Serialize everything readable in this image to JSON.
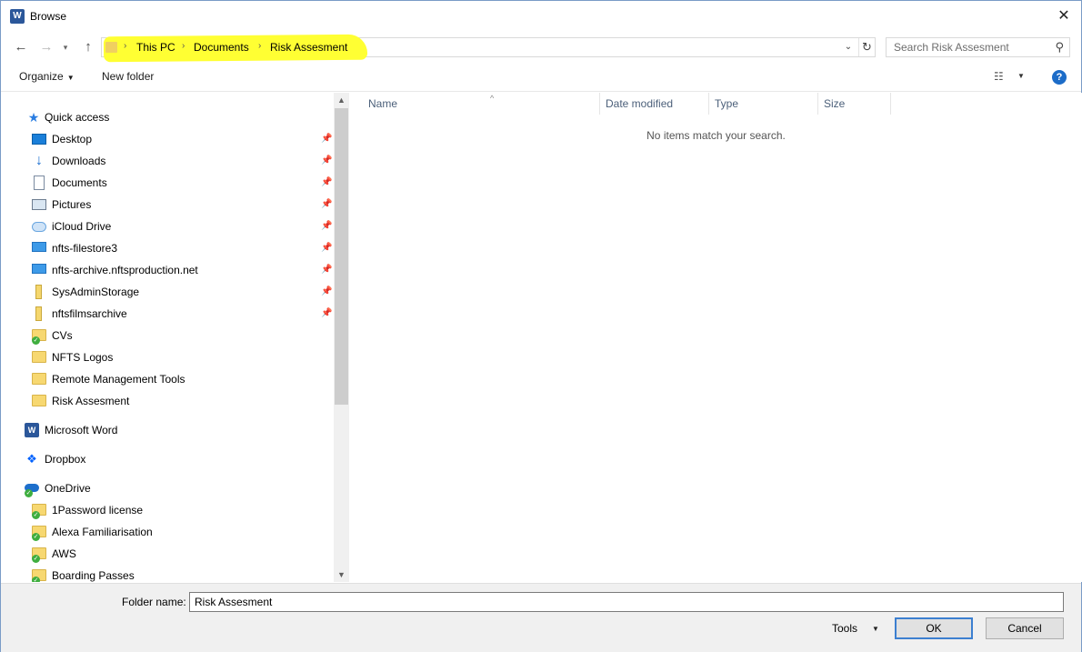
{
  "window": {
    "title": "Browse",
    "app_icon": "word-icon",
    "close_glyph": "✕"
  },
  "nav": {
    "back_glyph": "←",
    "forward_glyph": "→",
    "recent_glyph": "▾",
    "up_glyph": "↑"
  },
  "address": {
    "sep": "›",
    "crumbs": [
      "This PC",
      "Documents",
      "Risk Assesment"
    ],
    "dropdown_glyph": "⌄",
    "refresh_glyph": "↻",
    "highlight_color": "#ffff33"
  },
  "search": {
    "placeholder": "Search Risk Assesment",
    "icon_glyph": "⚲"
  },
  "toolbar": {
    "organize": "Organize",
    "organize_caret": "▼",
    "new_folder": "New folder",
    "view_glyph": "☷",
    "view_caret": "▼",
    "help_glyph": "?"
  },
  "sidebar": {
    "pin_glyph": "📌",
    "quick_access": "Quick access",
    "quick_access_items": [
      {
        "label": "Desktop",
        "icon": "desktop-icon",
        "pinned": true
      },
      {
        "label": "Downloads",
        "icon": "downloads-icon",
        "pinned": true
      },
      {
        "label": "Documents",
        "icon": "documents-icon",
        "pinned": true
      },
      {
        "label": "Pictures",
        "icon": "pictures-icon",
        "pinned": true
      },
      {
        "label": "iCloud Drive",
        "icon": "icloud-icon",
        "pinned": true
      },
      {
        "label": "nfts-filestore3",
        "icon": "network-drive-icon",
        "pinned": true
      },
      {
        "label": "nfts-archive.nftsproduction.net",
        "icon": "network-drive-icon",
        "pinned": true
      },
      {
        "label": "SysAdminStorage",
        "icon": "shared-folder-icon",
        "pinned": true
      },
      {
        "label": "nftsfilmsarchive",
        "icon": "shared-folder-icon",
        "pinned": true
      },
      {
        "label": "CVs",
        "icon": "synced-folder-icon",
        "pinned": false
      },
      {
        "label": "NFTS Logos",
        "icon": "folder-icon",
        "pinned": false
      },
      {
        "label": "Remote Management Tools",
        "icon": "folder-icon",
        "pinned": false
      },
      {
        "label": "Risk Assesment",
        "icon": "folder-icon",
        "pinned": false
      }
    ],
    "microsoft_word": "Microsoft Word",
    "dropbox": "Dropbox",
    "onedrive": "OneDrive",
    "onedrive_items": [
      {
        "label": "1Password license",
        "icon": "synced-folder-icon"
      },
      {
        "label": "Alexa Familiarisation",
        "icon": "synced-folder-icon"
      },
      {
        "label": "AWS",
        "icon": "synced-folder-icon"
      },
      {
        "label": "Boarding Passes",
        "icon": "synced-folder-icon"
      }
    ],
    "scroll_up_glyph": "▲",
    "scroll_down_glyph": "▼"
  },
  "file_list": {
    "columns": [
      "Name",
      "Date modified",
      "Type",
      "Size"
    ],
    "sort_glyph": "^",
    "empty_message": "No items match your search."
  },
  "footer": {
    "folder_name_label": "Folder name:",
    "folder_name_value": "Risk Assesment",
    "tools": "Tools",
    "tools_caret": "▼",
    "ok": "OK",
    "cancel": "Cancel"
  }
}
